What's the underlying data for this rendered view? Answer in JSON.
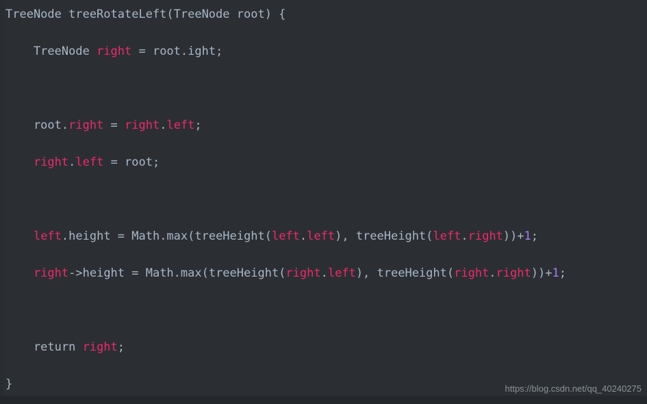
{
  "editor": {
    "background_color": "#2b2f33",
    "gutter_color": "#292d31",
    "bottom_bar_color": "#24282b",
    "plain_color": "#a9b7c6",
    "identifier_color": "#f0286a",
    "number_color": "#a87df0",
    "language": "java"
  },
  "code": {
    "lines": [
      {
        "index": 0,
        "text": "TreeNode treeRotateLeft(TreeNode root) {",
        "tokens": [
          {
            "text": "TreeNode treeRotateLeft(TreeNode root) {",
            "type": "plain"
          }
        ]
      },
      {
        "index": 1,
        "text": "",
        "tokens": []
      },
      {
        "index": 2,
        "text": "    TreeNode right = root.ight;",
        "tokens": [
          {
            "text": "    TreeNode ",
            "type": "plain"
          },
          {
            "text": "right",
            "type": "ident"
          },
          {
            "text": " = root.ight;",
            "type": "plain"
          }
        ]
      },
      {
        "index": 3,
        "text": "",
        "tokens": []
      },
      {
        "index": 4,
        "text": "",
        "tokens": []
      },
      {
        "index": 5,
        "text": "",
        "tokens": []
      },
      {
        "index": 6,
        "text": "    root.right = right.left;",
        "tokens": [
          {
            "text": "    root.",
            "type": "plain"
          },
          {
            "text": "right",
            "type": "ident"
          },
          {
            "text": " = ",
            "type": "plain"
          },
          {
            "text": "right",
            "type": "ident"
          },
          {
            "text": ".",
            "type": "plain"
          },
          {
            "text": "left",
            "type": "ident"
          },
          {
            "text": ";",
            "type": "plain"
          }
        ]
      },
      {
        "index": 7,
        "text": "",
        "tokens": []
      },
      {
        "index": 8,
        "text": "    right.left = root;",
        "tokens": [
          {
            "text": "    ",
            "type": "plain"
          },
          {
            "text": "right",
            "type": "ident"
          },
          {
            "text": ".",
            "type": "plain"
          },
          {
            "text": "left",
            "type": "ident"
          },
          {
            "text": " = root;",
            "type": "plain"
          }
        ]
      },
      {
        "index": 9,
        "text": "",
        "tokens": []
      },
      {
        "index": 10,
        "text": "",
        "tokens": []
      },
      {
        "index": 11,
        "text": "",
        "tokens": []
      },
      {
        "index": 12,
        "text": "    left.height = Math.max(treeHeight(left.left), treeHeight(left.right))+1;",
        "tokens": [
          {
            "text": "    ",
            "type": "plain"
          },
          {
            "text": "left",
            "type": "ident"
          },
          {
            "text": ".height = Math.max(treeHeight(",
            "type": "plain"
          },
          {
            "text": "left",
            "type": "ident"
          },
          {
            "text": ".",
            "type": "plain"
          },
          {
            "text": "left",
            "type": "ident"
          },
          {
            "text": "), treeHeight(",
            "type": "plain"
          },
          {
            "text": "left",
            "type": "ident"
          },
          {
            "text": ".",
            "type": "plain"
          },
          {
            "text": "right",
            "type": "ident"
          },
          {
            "text": "))+",
            "type": "plain"
          },
          {
            "text": "1",
            "type": "num"
          },
          {
            "text": ";",
            "type": "plain"
          }
        ]
      },
      {
        "index": 13,
        "text": "",
        "tokens": []
      },
      {
        "index": 14,
        "text": "    right->height = Math.max(treeHeight(right.left), treeHeight(right.right))+1;",
        "tokens": [
          {
            "text": "    ",
            "type": "plain"
          },
          {
            "text": "right",
            "type": "ident"
          },
          {
            "text": "->height = Math.max(treeHeight(",
            "type": "plain"
          },
          {
            "text": "right",
            "type": "ident"
          },
          {
            "text": ".",
            "type": "plain"
          },
          {
            "text": "left",
            "type": "ident"
          },
          {
            "text": "), treeHeight(",
            "type": "plain"
          },
          {
            "text": "right",
            "type": "ident"
          },
          {
            "text": ".",
            "type": "plain"
          },
          {
            "text": "right",
            "type": "ident"
          },
          {
            "text": "))+",
            "type": "plain"
          },
          {
            "text": "1",
            "type": "num"
          },
          {
            "text": ";",
            "type": "plain"
          }
        ]
      },
      {
        "index": 15,
        "text": "",
        "tokens": []
      },
      {
        "index": 16,
        "text": "",
        "tokens": []
      },
      {
        "index": 17,
        "text": "",
        "tokens": []
      },
      {
        "index": 18,
        "text": "    return right;",
        "tokens": [
          {
            "text": "    return ",
            "type": "plain"
          },
          {
            "text": "right",
            "type": "ident"
          },
          {
            "text": ";",
            "type": "plain"
          }
        ]
      },
      {
        "index": 19,
        "text": "",
        "tokens": []
      },
      {
        "index": 20,
        "text": "}",
        "tokens": [
          {
            "text": "}",
            "type": "plain"
          }
        ]
      }
    ]
  },
  "watermark": {
    "text": "https://blog.csdn.net/qq_40240275"
  }
}
